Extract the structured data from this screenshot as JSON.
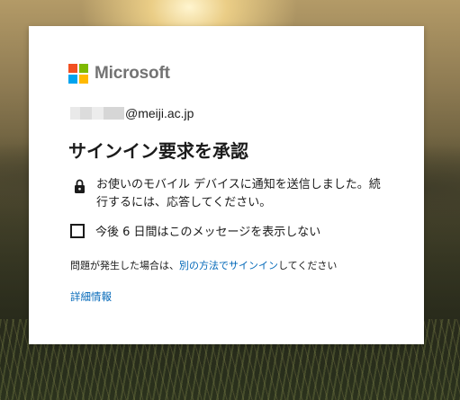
{
  "brand": {
    "name": "Microsoft",
    "logo_colors": [
      "#f25022",
      "#7fba00",
      "#00a4ef",
      "#ffb900"
    ],
    "logo_icon": "microsoft-logo-icon"
  },
  "identity": {
    "email_suffix": "@meiji.ac.jp"
  },
  "title": "サインイン要求を承認",
  "notice": {
    "icon": "lock-icon",
    "text": "お使いのモバイル デバイスに通知を送信しました。続行するには、応答してください。"
  },
  "remember": {
    "label": "今後 6 日間はこのメッセージを表示しない",
    "checked": false
  },
  "trouble": {
    "prefix": "問題が発生した場合は、",
    "link": "別の方法でサインイン",
    "suffix": "してください"
  },
  "details_link": "詳細情報",
  "colors": {
    "link": "#0067b8",
    "text": "#1b1b1b",
    "card": "#ffffff"
  }
}
